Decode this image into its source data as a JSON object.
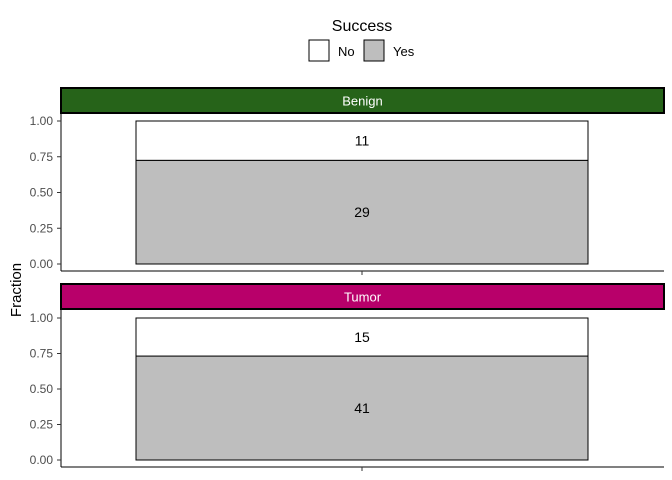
{
  "chart_data": {
    "type": "bar",
    "stacked": true,
    "legend": {
      "title": "Success",
      "position": "top",
      "entries": [
        {
          "label": "No",
          "color": "#ffffff"
        },
        {
          "label": "Yes",
          "color": "#bebebe"
        }
      ]
    },
    "ylabel": "Fraction",
    "xlabel": "",
    "ylim": [
      0,
      1
    ],
    "yticks": [
      "0.00",
      "0.25",
      "0.50",
      "0.75",
      "1.00"
    ],
    "panels": [
      {
        "strip_label": "Benign",
        "strip_color": "#266319",
        "segments": [
          {
            "series": "Yes",
            "fraction": 0.725,
            "count_label": "29"
          },
          {
            "series": "No",
            "fraction": 0.275,
            "count_label": "11"
          }
        ]
      },
      {
        "strip_label": "Tumor",
        "strip_color": "#b8006a",
        "segments": [
          {
            "series": "Yes",
            "fraction": 0.732,
            "count_label": "41"
          },
          {
            "series": "No",
            "fraction": 0.268,
            "count_label": "15"
          }
        ]
      }
    ]
  }
}
